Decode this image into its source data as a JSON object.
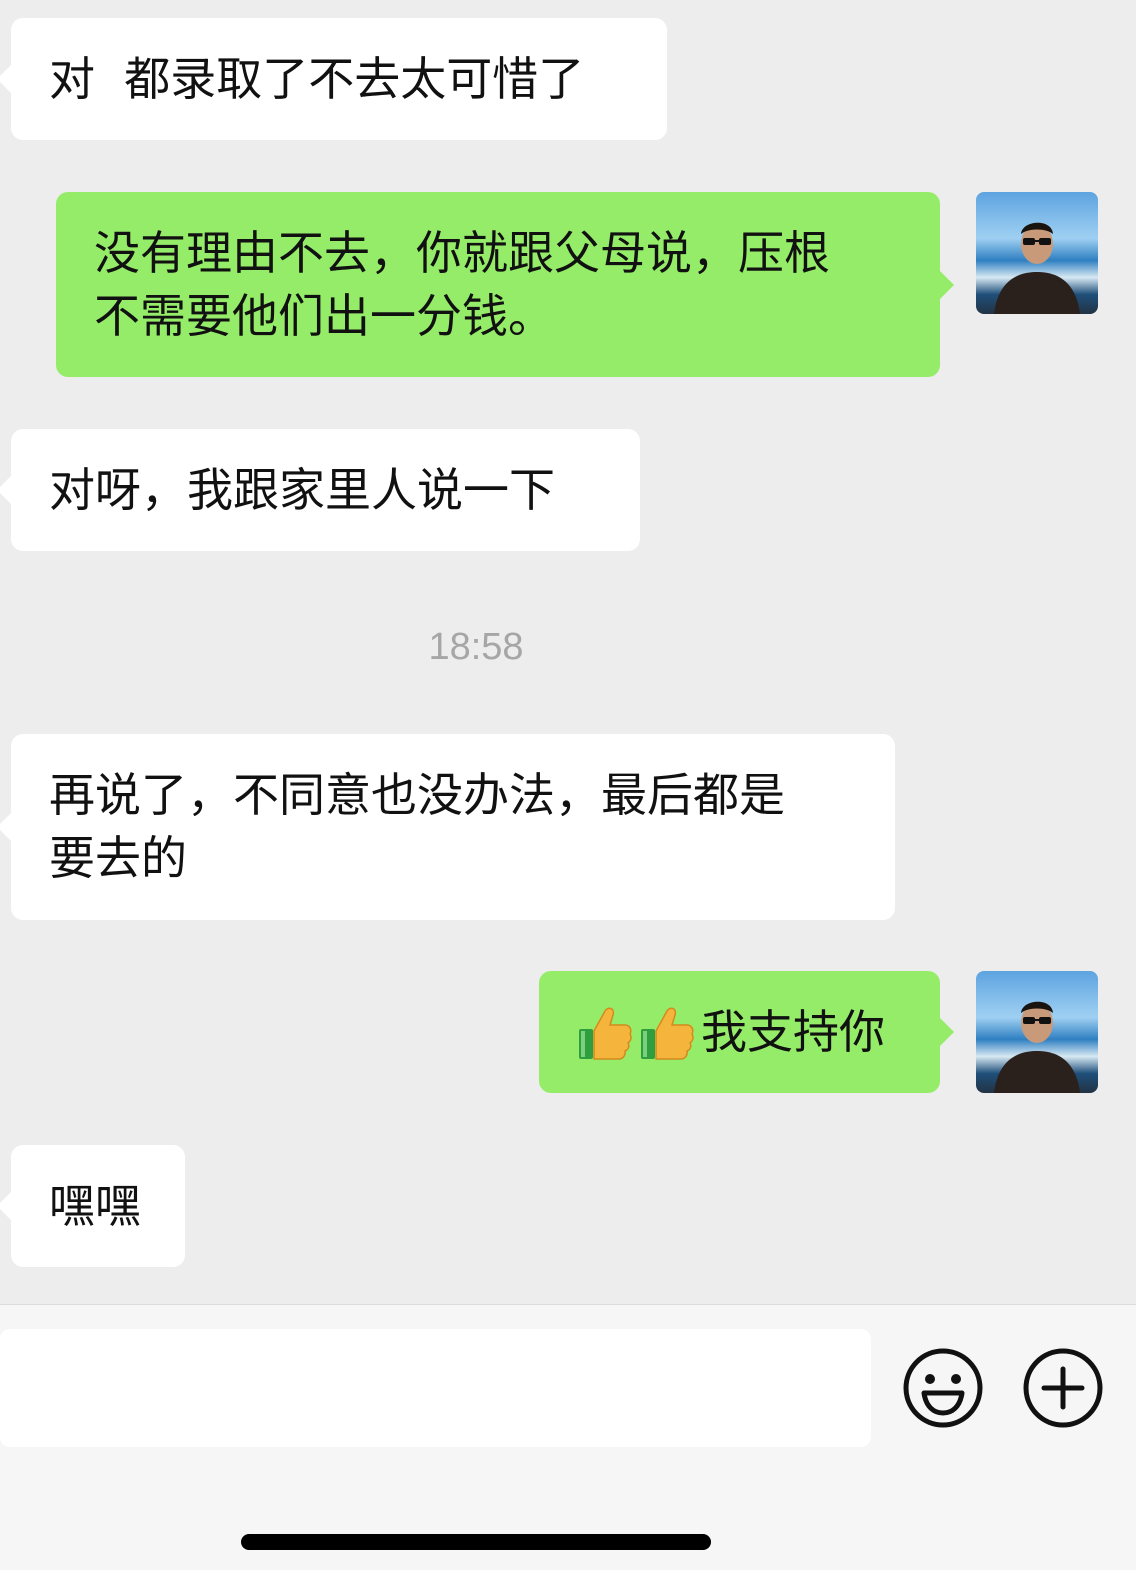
{
  "messages": [
    {
      "direction": "in",
      "text": "对  都录取了不去太可惜了"
    },
    {
      "direction": "out",
      "text": "没有理由不去，你就跟父母说，压根\n不需要他们出一分钱。"
    },
    {
      "direction": "in",
      "text": "对呀，我跟家里人说一下"
    },
    {
      "direction": "in",
      "text": "再说了，不同意也没办法，最后都是\n要去的"
    },
    {
      "direction": "out",
      "emoji": [
        "thumbs-up-icon",
        "thumbs-up-icon"
      ],
      "text": "我支持你"
    },
    {
      "direction": "in",
      "text": "嘿嘿"
    }
  ],
  "timestamp": "18:58",
  "input": {
    "value": ""
  },
  "toolbar": {
    "emoji_icon": "smiley-icon",
    "more_icon": "plus-circle-icon"
  },
  "colors": {
    "background": "#ededed",
    "incoming_bubble": "#ffffff",
    "outgoing_bubble": "#95ec69",
    "timestamp": "#a6a6a6"
  }
}
